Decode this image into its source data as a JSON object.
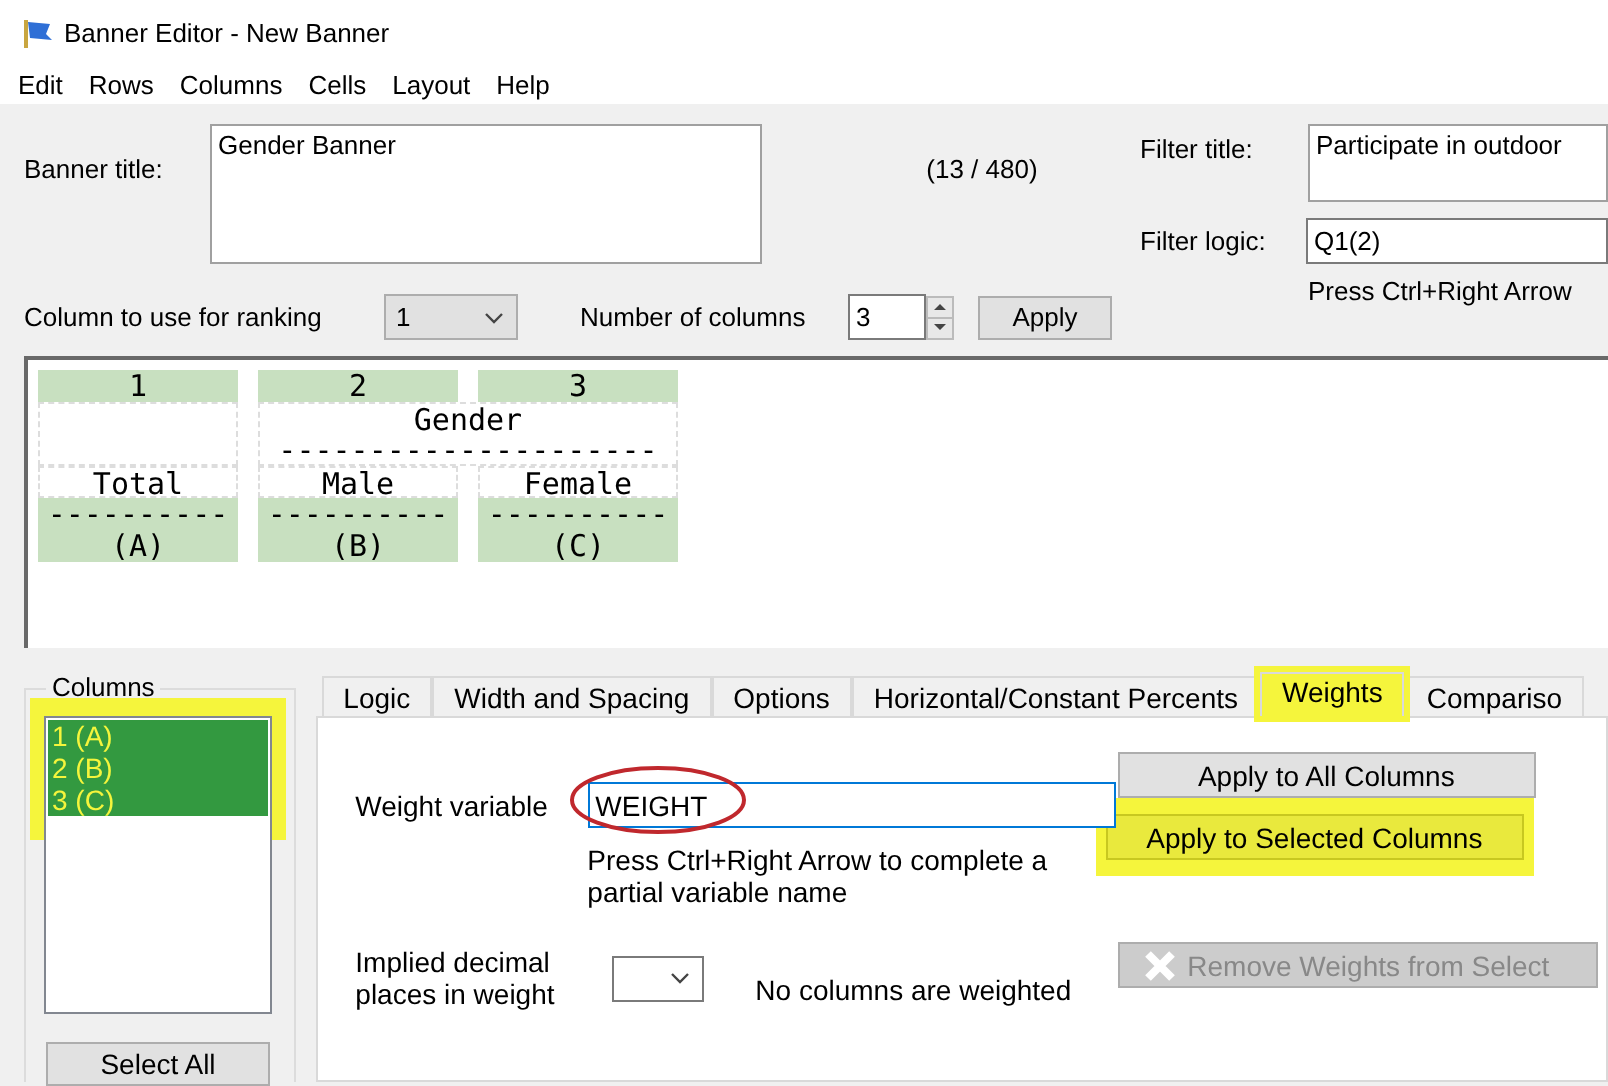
{
  "window": {
    "title": "Banner Editor - New Banner"
  },
  "menu": [
    "Edit",
    "Rows",
    "Columns",
    "Cells",
    "Layout",
    "Help"
  ],
  "banner_title": {
    "label": "Banner title:",
    "value": "Gender Banner",
    "count": "(13 / 480)"
  },
  "filter_title": {
    "label": "Filter title:",
    "value": "Participate in outdoor"
  },
  "filter_logic": {
    "label": "Filter logic:",
    "value": "Q1(2)",
    "hint": "Press Ctrl+Right Arrow"
  },
  "ranking": {
    "label": "Column to use for ranking",
    "value": "1"
  },
  "number_of_columns": {
    "label": "Number of columns",
    "value": "3",
    "button": "Apply"
  },
  "banner_preview": {
    "groups": [
      {
        "columns": [
          {
            "number": "1",
            "label": "Total",
            "rule": "----------",
            "letter": "(A)"
          }
        ]
      },
      {
        "title": "Gender",
        "underline": "---------------------",
        "columns": [
          {
            "number": "2",
            "label": "Male",
            "rule": "----------",
            "letter": "(B)"
          },
          {
            "number": "3",
            "label": "Female",
            "rule": "----------",
            "letter": "(C)"
          }
        ]
      }
    ]
  },
  "columns_box": {
    "title": "Columns",
    "highlighted": true,
    "items": [
      {
        "label": "1 (A)",
        "selected": true
      },
      {
        "label": "2 (B)",
        "selected": true
      },
      {
        "label": "3 (C)",
        "selected": true
      }
    ],
    "button": "Select All"
  },
  "tabs": [
    {
      "label": "Logic",
      "selected": false,
      "highlighted": false
    },
    {
      "label": "Width and Spacing",
      "selected": false,
      "highlighted": false
    },
    {
      "label": "Options",
      "selected": false,
      "highlighted": false
    },
    {
      "label": "Horizontal/Constant Percents",
      "selected": false,
      "highlighted": false
    },
    {
      "label": "Weights",
      "selected": true,
      "highlighted": true
    },
    {
      "label": "Compariso",
      "selected": false,
      "highlighted": false
    }
  ],
  "weights": {
    "variable_label": "Weight variable",
    "variable_value": "WEIGHT",
    "circled": true,
    "hint": "Press Ctrl+Right Arrow to complete a partial variable name",
    "decimals_label": "Implied decimal places in weight",
    "status": "No columns are weighted",
    "buttons": [
      {
        "label": "Apply to All Columns",
        "highlighted": false,
        "disabled": false
      },
      {
        "label": "Apply to Selected Columns",
        "highlighted": true,
        "disabled": false
      },
      {
        "label": "Remove Weights from Select",
        "highlighted": false,
        "disabled": true
      }
    ]
  }
}
